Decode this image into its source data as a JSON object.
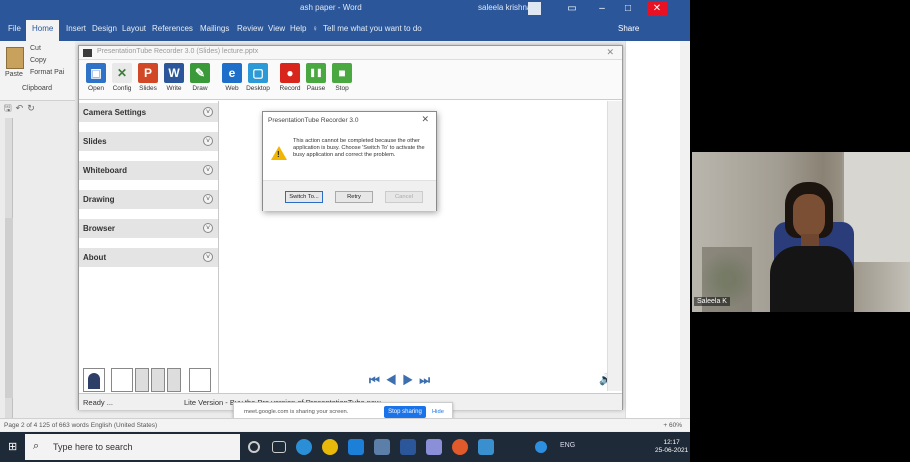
{
  "word": {
    "title": "ash paper - Word",
    "user": "saleela krishnan",
    "tabs": [
      "File",
      "Home",
      "Insert",
      "Design",
      "Layout",
      "References",
      "Mailings",
      "Review",
      "View",
      "Help",
      "Tell me what you want to do"
    ],
    "share": "Share",
    "clipboard": {
      "cut": "Cut",
      "copy": "Copy",
      "format_painter": "Format Pai",
      "paste": "Paste",
      "group": "Clipboard"
    },
    "status": "Page 2 of 4   125 of 663 words   English (United States)",
    "zoom": "+ 60%"
  },
  "recorder": {
    "title": "PresentationTube Recorder 3.0 (Slides) lecture.pptx",
    "toolbar": [
      {
        "label": "Open",
        "color": "#2f73c9",
        "glyph": "▣"
      },
      {
        "label": "Config",
        "color": "#e9e9e9",
        "glyph": "✕"
      },
      {
        "label": "Slides",
        "color": "#d24726",
        "glyph": "P"
      },
      {
        "label": "Write",
        "color": "#2b579a",
        "glyph": "W"
      },
      {
        "label": "Draw",
        "color": "#3a9a3a",
        "glyph": "✎"
      },
      {
        "label": "Web",
        "color": "#1e6fc9",
        "glyph": "e"
      },
      {
        "label": "Desktop",
        "color": "#2c9ad6",
        "glyph": "▢"
      },
      {
        "label": "Record",
        "color": "#d9261c",
        "glyph": "●"
      },
      {
        "label": "Pause",
        "color": "#4aa840",
        "glyph": "❚❚"
      },
      {
        "label": "Stop",
        "color": "#4aa840",
        "glyph": "■"
      }
    ],
    "panel": [
      "Camera Settings",
      "Slides",
      "Whiteboard",
      "Drawing",
      "Browser",
      "About"
    ],
    "status_ready": "Ready ...",
    "status_lite": "Lite Version - Buy the Pro version of PresentationTube now"
  },
  "dialog": {
    "title": "PresentationTube Recorder 3.0",
    "message": "This action cannot be completed because the other application is busy. Choose 'Switch To' to activate the busy application and correct the problem.",
    "buttons": [
      "Switch To...",
      "Retry",
      "Cancel"
    ]
  },
  "sharebar": {
    "text": "meet.google.com is sharing your screen.",
    "stop": "Stop sharing",
    "hide": "Hide"
  },
  "taskbar": {
    "search_placeholder": "Type here to search",
    "tray": "ENG",
    "time": "12:17",
    "date": "25-06-2021"
  },
  "camera": {
    "name": "Saleela K"
  }
}
